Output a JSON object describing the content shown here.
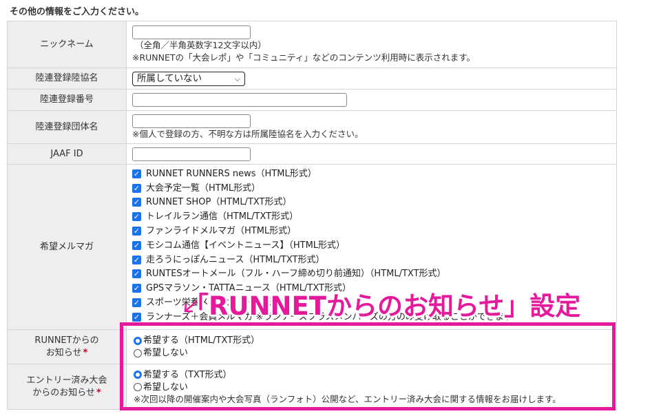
{
  "section_title": "その他の情報をご入力ください。",
  "rows": {
    "nickname": {
      "label": "ニックネーム",
      "value": "",
      "note1": "（全角／半角英数字12文字以内）",
      "note2": "※RUNNETの「大会レポ」や「コミュニティ」などのコンテンツ利用時に表示されます。"
    },
    "association": {
      "label": "陸連登録陸協名",
      "selected": "所属していない"
    },
    "reg_number": {
      "label": "陸連登録番号",
      "value": ""
    },
    "group_name": {
      "label": "陸連登録団体名",
      "value": "",
      "note": "※個人で登録の方、不明な方は所属陸協名を入力ください。"
    },
    "jaaf": {
      "label": "JAAF ID",
      "value": ""
    },
    "newsletters": {
      "label": "希望メルマガ",
      "items": [
        "RUNNET RUNNERS news（HTML形式）",
        "大会予定一覧（HTML形式）",
        "RUNNET SHOP（HTML/TXT形式）",
        "トレイルラン通信（HTML/TXT形式）",
        "ファンライドメルマガ（HTML形式）",
        "モシコム通信【イベントニュース】（HTML形式）",
        "走ろうにっぽんニュース（HTML/TXT形式）",
        "RUNTESオートメール（フル・ハーフ締め切り前通知）（HTML/TXT形式）",
        "GPSマラソン・TATTAニュース（HTML/TXT形式）",
        "スポーツ栄養メルマガ（HTML形式）",
        "ランナーズ＋会員メルマガ ※ランナーズプラスメンバーズの方のみ受け取ることができます"
      ]
    },
    "runnet_notice": {
      "label_line1": "RUNNETからの",
      "label_line2": "お知らせ",
      "required_mark": "*",
      "option_yes": "希望する（HTML/TXT形式）",
      "option_no": "希望しない",
      "selected": "yes"
    },
    "entry_notice": {
      "label_line1": "エントリー済み大会",
      "label_line2": "からのお知らせ",
      "required_mark": "*",
      "option_yes": "希望する（TXT形式）",
      "option_no": "希望しない",
      "note": "※次回以降の開催案内や大会写真（ランフォト）公開など、エントリー済み大会に関する情報をお届けします。",
      "selected": "yes"
    }
  },
  "annotation": {
    "text": "「RUNNETからのお知らせ」設定",
    "color": "#e5199b"
  },
  "icons": {
    "checkbox": "checkbox-checked-icon",
    "radio": "radio-icon",
    "select": "chevron-down-icon"
  }
}
